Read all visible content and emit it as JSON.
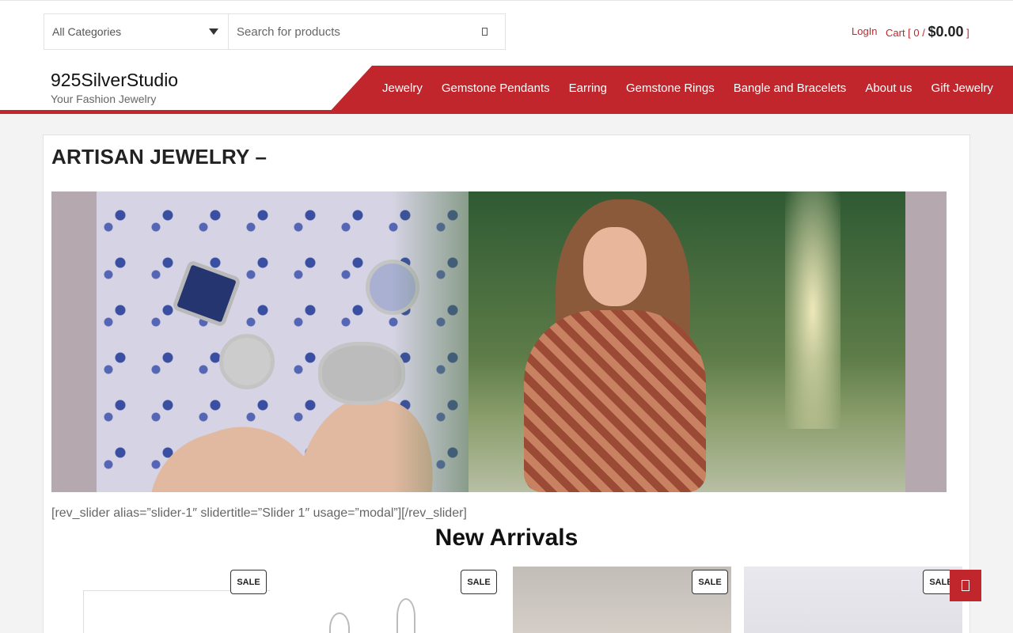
{
  "search": {
    "category_selected": "All Categories",
    "placeholder": "Search for products"
  },
  "account": {
    "login_label": "LogIn",
    "cart_prefix": "Cart [ ",
    "cart_count": "0",
    "cart_sep": " / ",
    "cart_total": "$0.00",
    "cart_suffix": " ]"
  },
  "brand": {
    "title": "925SilverStudio",
    "tagline": "Your Fashion Jewelry"
  },
  "nav": {
    "items": [
      "Jewelry",
      "Gemstone Pendants",
      "Earring",
      "Gemstone Rings",
      "Bangle and Bracelets",
      "About us",
      "Gift Jewelry"
    ]
  },
  "page": {
    "title": "ARTISAN JEWELRY –",
    "shortcode": "[rev_slider alias=”slider-1″ slidertitle=”Slider 1″ usage=”modal”][/rev_slider]",
    "section_title": "New Arrivals"
  },
  "products": [
    {
      "badge": "SALE"
    },
    {
      "badge": "SALE"
    },
    {
      "badge": "SALE"
    },
    {
      "badge": "SALE"
    }
  ],
  "icons": {
    "search": "search-icon",
    "dropdown": "chevron-down-icon",
    "floating": "floating-action-icon"
  },
  "colors": {
    "accent": "#c0262b",
    "background": "#f3f3f3"
  }
}
